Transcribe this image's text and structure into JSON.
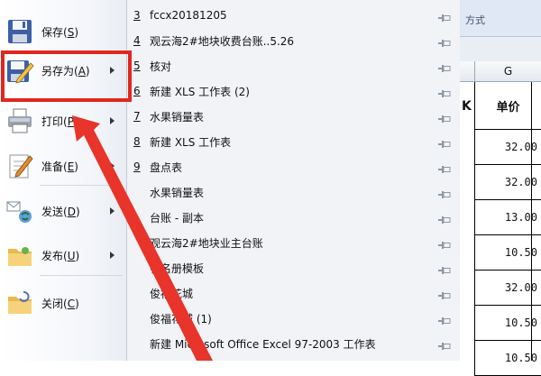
{
  "menu": [
    {
      "label": "保存",
      "key": "S",
      "icon": "floppy-disk-icon",
      "submenu": false
    },
    {
      "label": "另存为",
      "key": "A",
      "icon": "save-as-icon",
      "submenu": true
    },
    {
      "label": "打印",
      "key": "P",
      "icon": "printer-icon",
      "submenu": true
    },
    {
      "label": "准备",
      "key": "E",
      "icon": "prepare-checklist-icon",
      "submenu": true
    },
    {
      "label": "发送",
      "key": "D",
      "icon": "send-network-icon",
      "submenu": true
    },
    {
      "label": "发布",
      "key": "U",
      "icon": "publish-folder-icon",
      "submenu": true
    },
    {
      "label": "关闭",
      "key": "C",
      "icon": "close-folder-icon",
      "submenu": false
    }
  ],
  "recent_documents": [
    {
      "num": "3",
      "name": "fccx20181205"
    },
    {
      "num": "4",
      "name": "观云海2#地块收费台账..5.26"
    },
    {
      "num": "5",
      "name": "核对"
    },
    {
      "num": "6",
      "name": "新建 XLS 工作表 (2)"
    },
    {
      "num": "7",
      "name": "水果销量表"
    },
    {
      "num": "8",
      "name": "新建 XLS 工作表"
    },
    {
      "num": "9",
      "name": "盘点表"
    },
    {
      "num": "",
      "name": "水果销量表"
    },
    {
      "num": "",
      "name": "台账 - 副本"
    },
    {
      "num": "",
      "name": "观云海2#地块业主台账"
    },
    {
      "num": "",
      "name": "花名册模板"
    },
    {
      "num": "",
      "name": "俊福花城"
    },
    {
      "num": "",
      "name": "俊福花城 (1)"
    },
    {
      "num": "",
      "name": "新建 Microsoft Office Excel 97-2003 工作表"
    }
  ],
  "spreadsheet": {
    "ribbon_fragment": "方式",
    "column_letter": "G",
    "header_fragment": "K",
    "column_title": "单价",
    "prices": [
      "32.00",
      "32.00",
      "13.00",
      "10.50",
      "32.00",
      "10.50",
      "10.50"
    ]
  },
  "colors": {
    "highlight": "#e0271f",
    "arrow": "#e8342a"
  }
}
